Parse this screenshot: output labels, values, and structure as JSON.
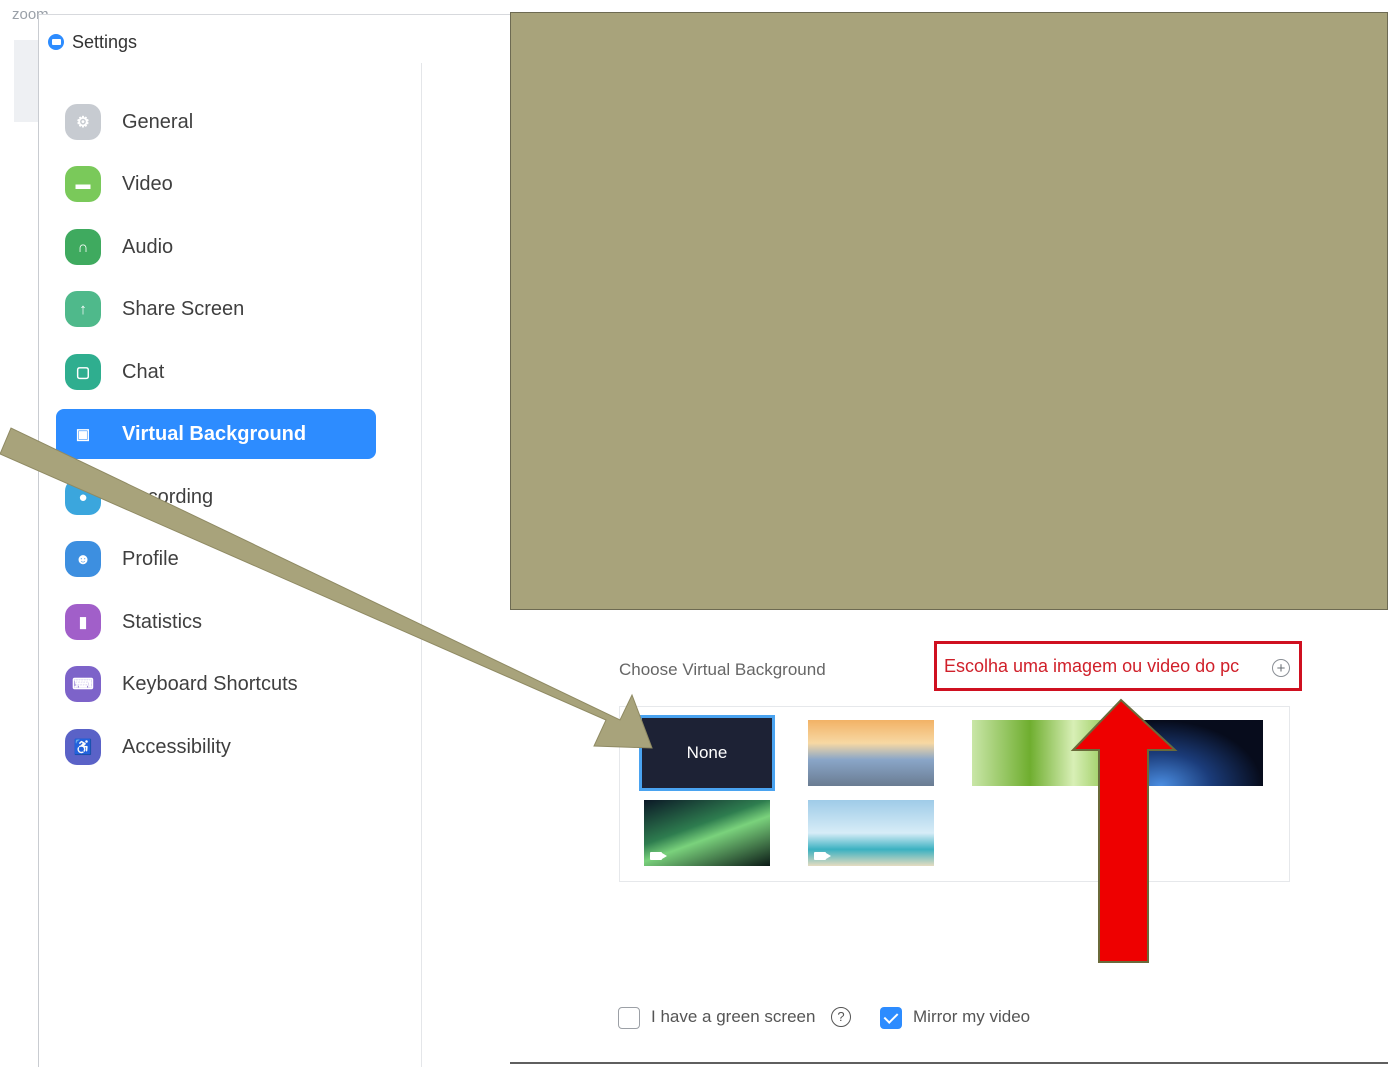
{
  "background_app": {
    "label": "zoom"
  },
  "window": {
    "title": "Settings",
    "brand_color": "#2d8cff"
  },
  "sidebar": {
    "items": [
      {
        "label": "General",
        "icon": "gear-icon",
        "color": "#c7cbd1"
      },
      {
        "label": "Video",
        "icon": "video-icon",
        "color": "#7ac95a"
      },
      {
        "label": "Audio",
        "icon": "headphones-icon",
        "color": "#3faa5f"
      },
      {
        "label": "Share Screen",
        "icon": "share-screen-icon",
        "color": "#4fb98b"
      },
      {
        "label": "Chat",
        "icon": "chat-icon",
        "color": "#2fae8f"
      },
      {
        "label": "Virtual Background",
        "icon": "person-icon",
        "color": "#2d8cff",
        "active": true
      },
      {
        "label": "Recording",
        "icon": "record-icon",
        "color": "#3ba6dd"
      },
      {
        "label": "Profile",
        "icon": "profile-icon",
        "color": "#3d8fe0"
      },
      {
        "label": "Statistics",
        "icon": "statistics-icon",
        "color": "#a15fc9"
      },
      {
        "label": "Keyboard Shortcuts",
        "icon": "keyboard-icon",
        "color": "#7d63c9"
      },
      {
        "label": "Accessibility",
        "icon": "accessibility-icon",
        "color": "#5a62c7"
      }
    ]
  },
  "main": {
    "preview_color": "#a8a37b",
    "choose_label": "Choose Virtual Background",
    "add_link": {
      "label": "Escolha uma imagem ou video do pc",
      "highlight_color": "#cf1020"
    },
    "backgrounds": [
      {
        "label": "None",
        "selected": true
      },
      {
        "name": "golden-gate-bridge"
      },
      {
        "name": "grass"
      },
      {
        "name": "earth-from-space"
      },
      {
        "name": "aurora",
        "video": true
      },
      {
        "name": "beach",
        "video": true
      }
    ],
    "green_screen": {
      "label": "I have a green screen",
      "checked": false
    },
    "mirror": {
      "label": "Mirror my video",
      "checked": true
    }
  },
  "annotations": {
    "arrow_color": "#a8a37b",
    "red_arrow_color": "#ee0000"
  }
}
